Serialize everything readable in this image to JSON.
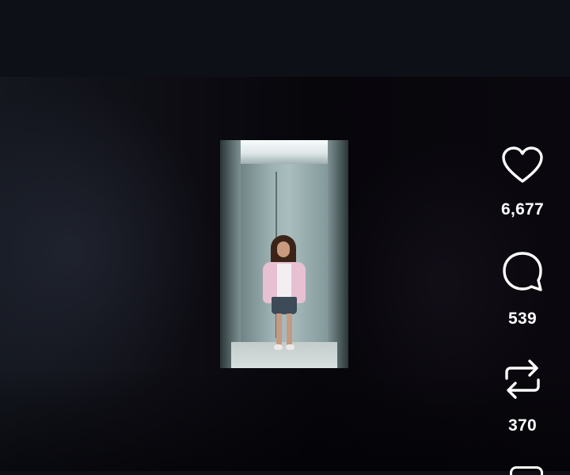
{
  "actions": {
    "like": {
      "icon": "heart-outline-icon",
      "count": "6,677"
    },
    "comment": {
      "icon": "speech-bubble-icon",
      "count": "539"
    },
    "repost": {
      "icon": "repost-arrows-icon",
      "count": "370"
    },
    "next": {
      "icon": "share-icon"
    }
  }
}
